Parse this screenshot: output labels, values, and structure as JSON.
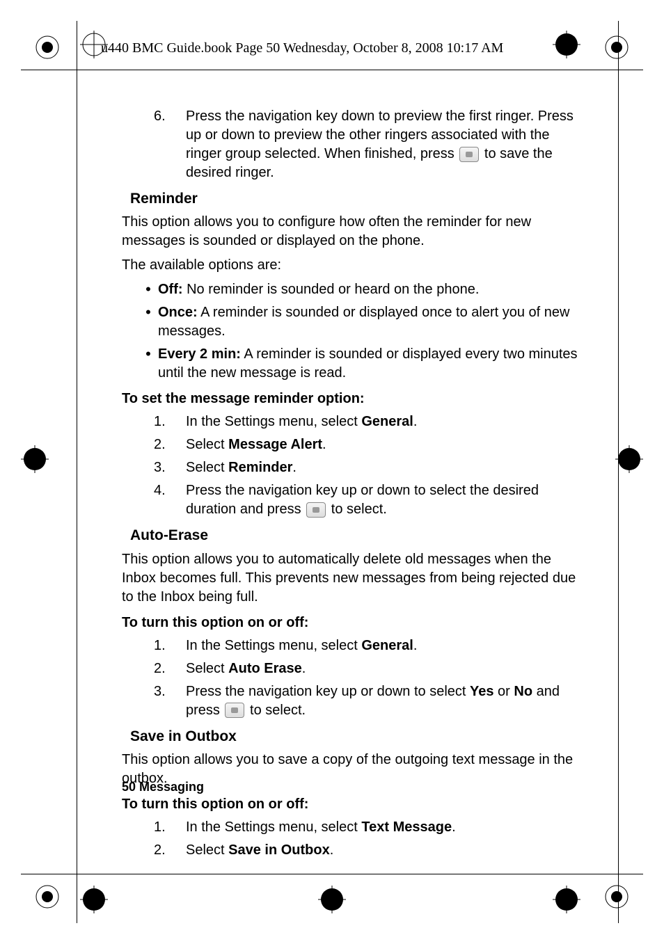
{
  "header": "u440 BMC Guide.book  Page 50  Wednesday, October 8, 2008  10:17 AM",
  "step6": {
    "num": "6.",
    "text_a": "Press the navigation key down to preview the first ringer. Press up or down to preview the other ringers associated with the ringer group selected. When finished, press ",
    "text_b": " to save the desired ringer."
  },
  "reminder": {
    "title": "Reminder",
    "p1": "This option allows you to configure how often the reminder for new messages is sounded or displayed on the phone.",
    "p2": "The available options are:",
    "bullets": [
      {
        "label": "Off:",
        "text": " No reminder is sounded or heard on the phone."
      },
      {
        "label": "Once:",
        "text": " A reminder is sounded or displayed once to alert you of new messages."
      },
      {
        "label": "Every 2 min:",
        "text": " A reminder is sounded or displayed every two minutes until the new message is read."
      }
    ],
    "howto_title": "To set the message reminder option:",
    "steps": [
      {
        "num": "1.",
        "a": "In the Settings menu, select ",
        "b": "General",
        "c": "."
      },
      {
        "num": "2.",
        "a": "Select ",
        "b": "Message Alert",
        "c": "."
      },
      {
        "num": "3.",
        "a": "Select ",
        "b": "Reminder",
        "c": "."
      },
      {
        "num": "4.",
        "a": "Press the navigation key up or down to select the desired duration and press ",
        "c": " to select."
      }
    ]
  },
  "autoerase": {
    "title": "Auto-Erase",
    "p1": "This option allows you to automatically delete old messages when the Inbox becomes full. This prevents new messages from being rejected due to the Inbox being full.",
    "howto_title": "To turn this option on or off:",
    "steps": [
      {
        "num": "1.",
        "a": "In the Settings menu, select ",
        "b": "General",
        "c": "."
      },
      {
        "num": "2.",
        "a": "Select ",
        "b": "Auto Erase",
        "c": "."
      },
      {
        "num": "3.",
        "a": "Press the navigation key up or down to select ",
        "b": "Yes",
        "mid": " or ",
        "b2": "No",
        "c": " and press ",
        "d": " to select."
      }
    ]
  },
  "saveoutbox": {
    "title": "Save in Outbox",
    "p1": "This option allows you to save a copy of the outgoing text message in the outbox.",
    "howto_title": "To turn this option on or off:",
    "steps": [
      {
        "num": "1.",
        "a": "In the Settings menu, select ",
        "b": "Text Message",
        "c": "."
      },
      {
        "num": "2.",
        "a": "Select ",
        "b": "Save in Outbox",
        "c": "."
      }
    ]
  },
  "footer": "50    Messaging"
}
